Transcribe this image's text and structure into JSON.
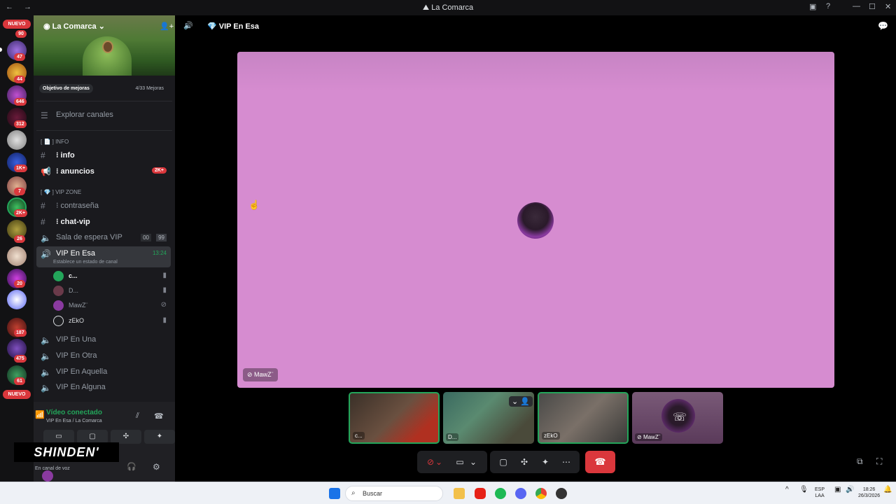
{
  "window": {
    "title": "La Comarca",
    "nav": "← →"
  },
  "rail": {
    "nuevo_top": "NUEVO",
    "nuevo_bottom": "NUEVO",
    "badges": [
      "90",
      "47",
      "44",
      "646",
      "312",
      "1K+",
      "7",
      "2K+",
      "26",
      "20",
      "187",
      "475",
      "61"
    ]
  },
  "server": {
    "name": "La Comarca",
    "boost_label": "Objetivo de mejoras",
    "boost_progress": "4/33 Mejoras",
    "browse": "Explorar canales"
  },
  "categories": {
    "info": "[ 📄 ] INFO",
    "vip": "[ 💎 ] VIP ZONE"
  },
  "channels": {
    "info": "⁝ info",
    "anuncios": "⁝ anuncios",
    "anuncios_badge": "2K+",
    "contrasena": "⁝ contraseña",
    "chatvip": "⁝ chat-vip",
    "sala": "Sala de espera VIP",
    "sala_count_a": "00",
    "sala_count_b": "99",
    "vip_esa": "VIP En Esa",
    "vip_esa_time": "13:24",
    "vip_esa_status": "Establece un estado de canal",
    "vip_una": "VIP En Una",
    "vip_otra": "VIP En Otra",
    "vip_aquella": "VIP En Aquella",
    "vip_alguna": "VIP En Alguna"
  },
  "voice_users": [
    {
      "name": "c..."
    },
    {
      "name": "D..."
    },
    {
      "name": "MawZ¨"
    },
    {
      "name": "zEkO"
    }
  ],
  "voice_panel": {
    "status": "Vídeo conectado",
    "location": "VIP En Esa / La Comarca",
    "user_status": "En canal de voz",
    "overlay": "SHINDEN'"
  },
  "main": {
    "channel": "VIP En Esa",
    "focused_user": "MawZ¨",
    "thumbs": [
      "c...",
      "D...",
      "zEkO",
      "MawZ¨"
    ]
  },
  "taskbar": {
    "search": "Buscar",
    "lang": "ESP",
    "layout": "LAA",
    "time": "18:26",
    "date": "26/3/2026"
  },
  "colors": {
    "stage": "#d68cd0",
    "accent_green": "#23a55a",
    "hangup": "#da373c",
    "badge": "#da373c"
  }
}
